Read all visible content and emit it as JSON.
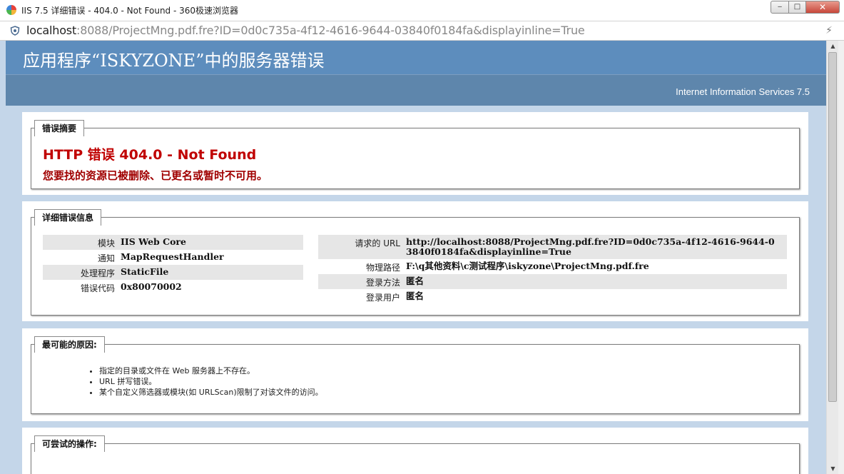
{
  "window": {
    "title": "IIS 7.5 详细错误 - 404.0 - Not Found - 360极速浏览器",
    "min_label": "‒",
    "max_label": "□",
    "close_label": "✕"
  },
  "address": {
    "host": "localhost",
    "rest": ":8088/ProjectMng.pdf.fre?ID=0d0c735a-4f12-4616-9644-03840f0184fa&displayinline=True"
  },
  "header": {
    "title": "应用程序“ISKYZONE”中的服务器错误",
    "iis_version": "Internet Information Services 7.5"
  },
  "summary": {
    "legend": "错误摘要",
    "error_title": "HTTP 错误 404.0 - Not Found",
    "error_desc": "您要找的资源已被删除、已更名或暂时不可用。"
  },
  "details": {
    "legend": "详细错误信息",
    "left": [
      {
        "label": "模块",
        "value": "IIS Web Core"
      },
      {
        "label": "通知",
        "value": "MapRequestHandler"
      },
      {
        "label": "处理程序",
        "value": "StaticFile"
      },
      {
        "label": "错误代码",
        "value": "0x80070002"
      }
    ],
    "right": [
      {
        "label": "请求的 URL",
        "value": "http://localhost:8088/ProjectMng.pdf.fre?ID=0d0c735a-4f12-4616-9644-03840f0184fa&displayinline=True"
      },
      {
        "label": "物理路径",
        "value": "F:\\q其他资料\\c测试程序\\iskyzone\\ProjectMng.pdf.fre"
      },
      {
        "label": "登录方法",
        "value": "匿名"
      },
      {
        "label": "登录用户",
        "value": "匿名"
      }
    ]
  },
  "causes": {
    "legend": "最可能的原因:",
    "items": [
      "指定的目录或文件在 Web 服务器上不存在。",
      "URL 拼写错误。",
      "某个自定义筛选器或模块(如 URLScan)限制了对该文件的访问。"
    ]
  },
  "actions": {
    "legend": "可尝试的操作:"
  }
}
